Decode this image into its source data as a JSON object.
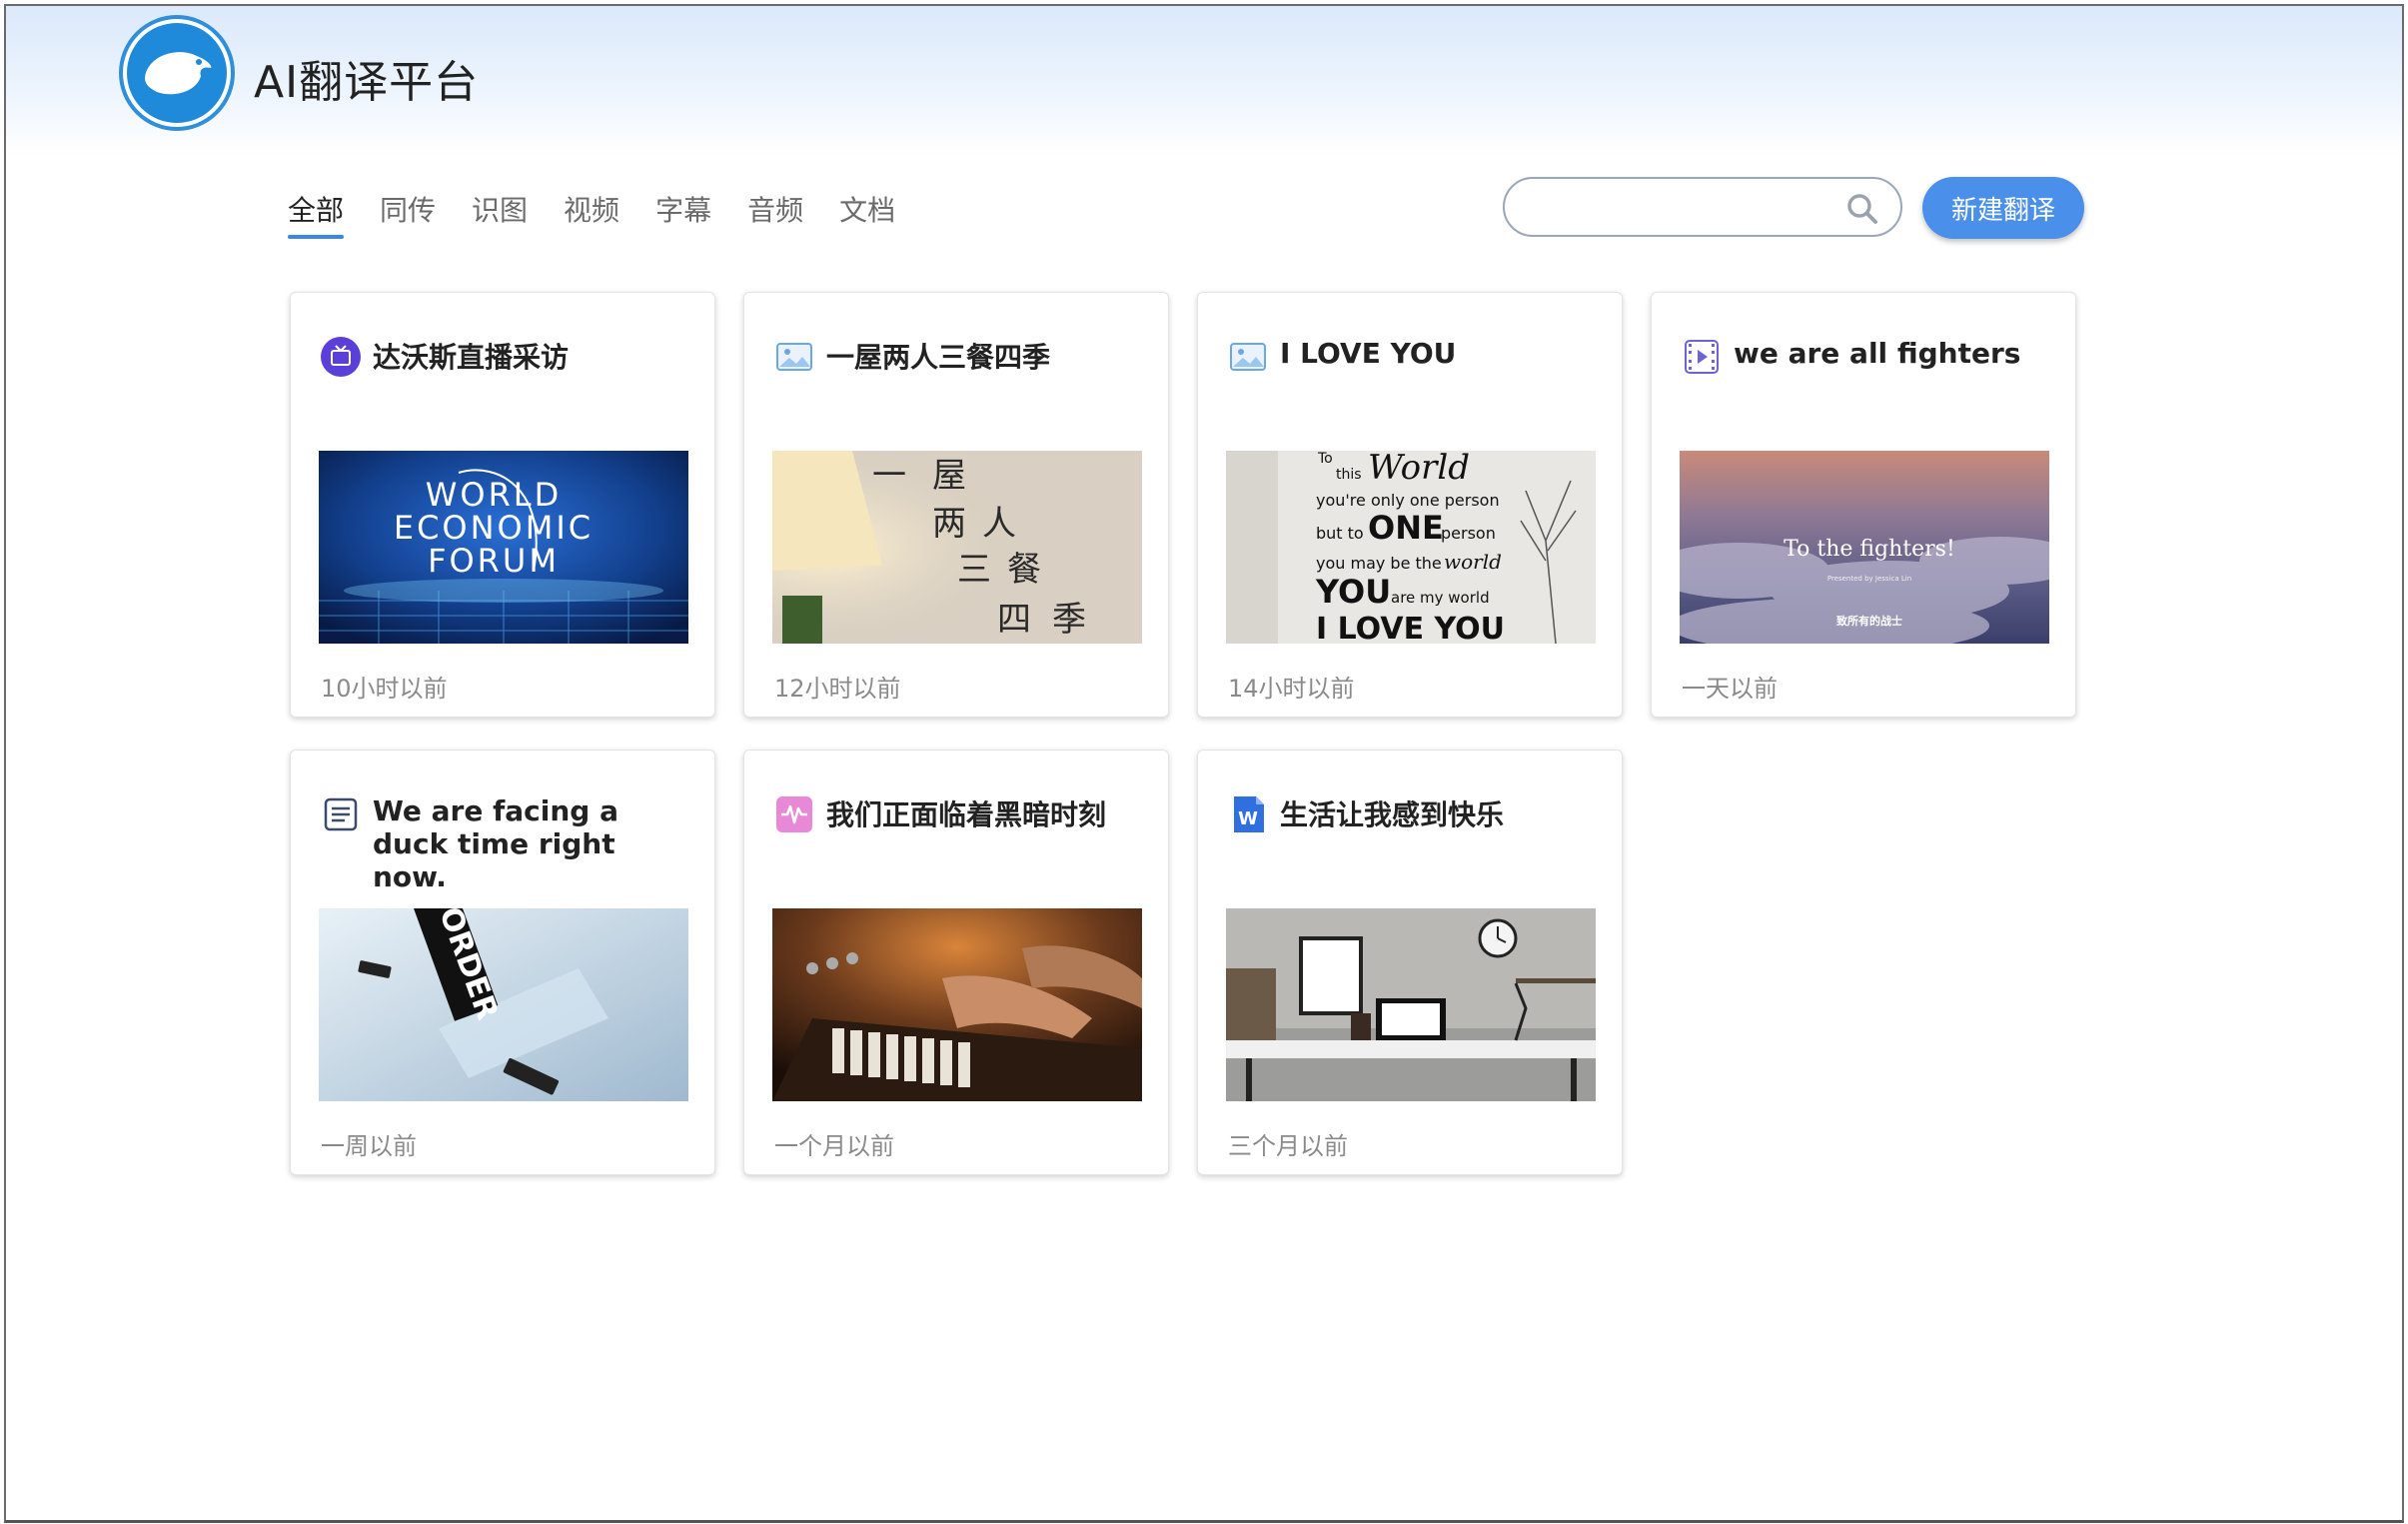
{
  "app": {
    "title": "AI翻译平台"
  },
  "tabs": [
    {
      "label": "全部",
      "active": true
    },
    {
      "label": "同传",
      "active": false
    },
    {
      "label": "识图",
      "active": false
    },
    {
      "label": "视频",
      "active": false
    },
    {
      "label": "字幕",
      "active": false
    },
    {
      "label": "音频",
      "active": false
    },
    {
      "label": "文档",
      "active": false
    }
  ],
  "search": {
    "value": "",
    "placeholder": ""
  },
  "new_button": {
    "label": "新建翻译"
  },
  "colors": {
    "accent": "#4a90ea",
    "tab_underline": "#3c86e6",
    "logo": "#1f8ad9"
  },
  "cards": [
    {
      "title": "达沃斯直播采访",
      "time": "10小时以前",
      "icon": "live-icon",
      "thumb": {
        "line1": "WORLD",
        "line2": "ECONOMIC",
        "line3": "FORUM"
      }
    },
    {
      "title": "一屋两人三餐四季",
      "time": "12小时以前",
      "icon": "image-icon",
      "thumb": {
        "c1": "一",
        "c2": "屋",
        "c3": "两",
        "c4": "人",
        "c5": "三",
        "c6": "餐",
        "c7": "四",
        "c8": "季"
      }
    },
    {
      "title": "I LOVE YOU",
      "time": "14小时以前",
      "icon": "image-icon",
      "thumb": {
        "t1": "To",
        "t2": "this",
        "t3": "World",
        "t4": "you're only one person",
        "t5": "but to",
        "t6": "ONE",
        "t7": "person",
        "t8": "you may be the",
        "t9": "world",
        "t10": "YOU",
        "t11": "are my world",
        "t12": "I LOVE YOU"
      }
    },
    {
      "title": "we are all fighters",
      "time": "一天以前",
      "icon": "video-icon",
      "thumb": {
        "headline": "To the fighters!",
        "sub": "Presented by Jessica Lin",
        "cn": "致所有的战士"
      }
    },
    {
      "title": "We are facing a duck time right now.",
      "time": "一周以前",
      "icon": "subtitle-icon",
      "thumb": {
        "word": "ORDER"
      }
    },
    {
      "title": "我们正面临着黑暗时刻",
      "time": "一个月以前",
      "icon": "audio-icon",
      "thumb": {}
    },
    {
      "title": "生活让我感到快乐",
      "time": "三个月以前",
      "icon": "word-doc-icon",
      "thumb": {
        "badge": "W"
      }
    }
  ]
}
